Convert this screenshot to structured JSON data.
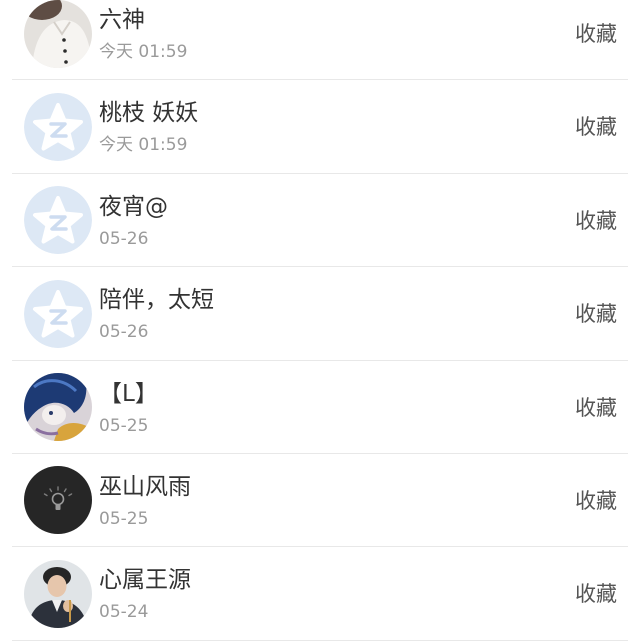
{
  "list": [
    {
      "name": "六神",
      "date": "今天 01:59",
      "action": "收藏",
      "avatar": "photo-portrait-light-avatar"
    },
    {
      "name": "桃枝 妖妖",
      "date": "今天 01:59",
      "action": "收藏",
      "avatar": "default-star-avatar"
    },
    {
      "name": "夜宵@",
      "date": "05-26",
      "action": "收藏",
      "avatar": "default-star-avatar"
    },
    {
      "name": "陪伴，太短",
      "date": "05-26",
      "action": "收藏",
      "avatar": "default-star-avatar"
    },
    {
      "name": "【L】",
      "date": "05-25",
      "action": "收藏",
      "avatar": "anime-portrait-avatar"
    },
    {
      "name": "巫山风雨",
      "date": "05-25",
      "action": "收藏",
      "avatar": "lightbulb-avatar"
    },
    {
      "name": "心属王源",
      "date": "05-24",
      "action": "收藏",
      "avatar": "photo-portrait-jacket-avatar"
    }
  ],
  "colors": {
    "name_text": "#333333",
    "date_text": "#9a9a9a",
    "action_text": "#555555",
    "divider": "#e8e8e8",
    "default_avatar_bg": "#dde8f5"
  }
}
